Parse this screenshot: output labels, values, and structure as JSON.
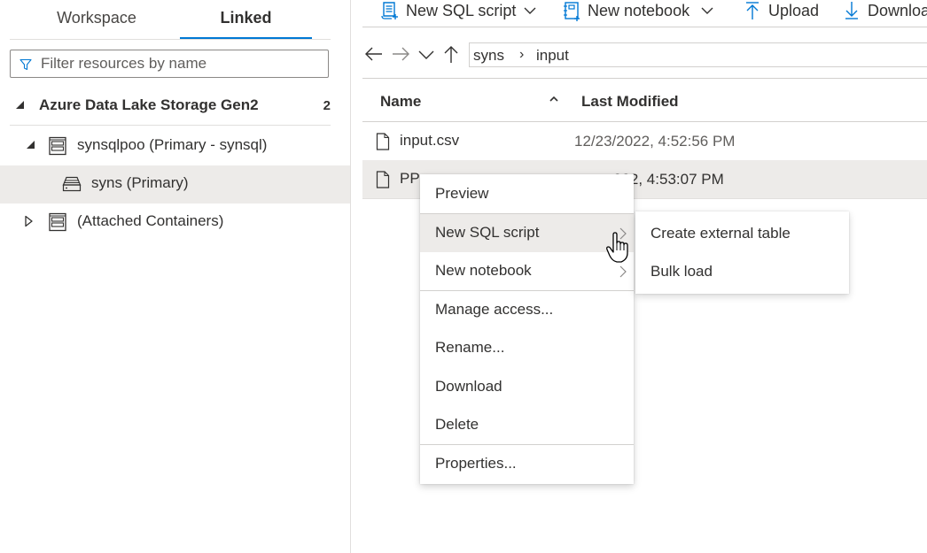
{
  "left_panel": {
    "tabs": [
      {
        "label": "Workspace",
        "active": false
      },
      {
        "label": "Linked",
        "active": true
      }
    ],
    "filter": {
      "placeholder": "Filter resources by name",
      "value": ""
    },
    "tree": {
      "root": {
        "label": "Azure Data Lake Storage Gen2",
        "count": "2",
        "expanded": true
      },
      "items": [
        {
          "label": "synsqlpoo (Primary - synsql)",
          "icon": "storage-account-icon",
          "expanded": true
        },
        {
          "label": "syns (Primary)",
          "icon": "container-icon",
          "selected": true
        },
        {
          "label": "(Attached Containers)",
          "icon": "storage-account-icon",
          "expanded": false
        }
      ]
    }
  },
  "toolbar": {
    "new_sql_script": "New SQL script",
    "new_notebook": "New notebook",
    "upload": "Upload",
    "download": "Download"
  },
  "address_bar": {
    "segments": [
      "syns",
      "input"
    ],
    "separator": "›"
  },
  "file_list": {
    "columns": {
      "name": "Name",
      "last_modified": "Last Modified"
    },
    "sort": "ascending",
    "rows": [
      {
        "name": "input.csv",
        "last_modified": "12/23/2022, 4:52:56 PM"
      },
      {
        "name": "PP",
        "last_modified": "022, 4:53:07 PM",
        "selected": true
      }
    ]
  },
  "context_menu": {
    "items": [
      {
        "label": "Preview"
      },
      {
        "label": "New SQL script",
        "submenu": true,
        "hovered": true
      },
      {
        "label": "New notebook",
        "submenu": true
      },
      {
        "label": "Manage access..."
      },
      {
        "label": "Rename..."
      },
      {
        "label": "Download"
      },
      {
        "label": "Delete"
      },
      {
        "label": "Properties..."
      }
    ]
  },
  "submenu": {
    "items": [
      {
        "label": "Create external table"
      },
      {
        "label": "Bulk load"
      }
    ]
  },
  "colors": {
    "accent": "#0078d4",
    "selected_bg": "#edebe9",
    "text": "#323130",
    "secondary_text": "#605e5c"
  }
}
